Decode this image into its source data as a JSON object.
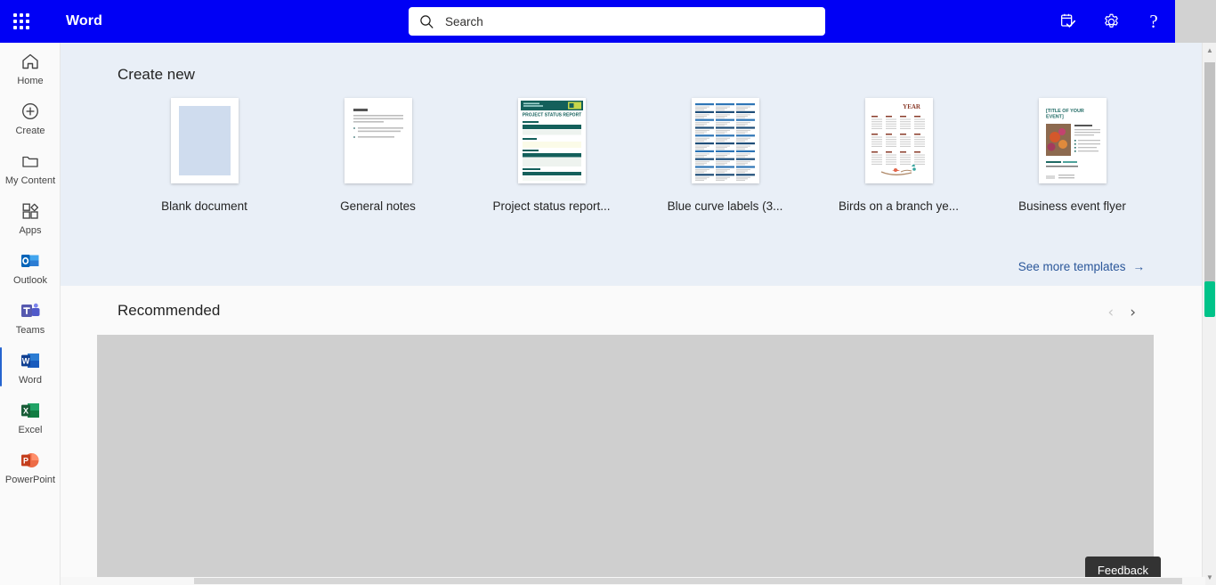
{
  "topbar": {
    "waffle_label": "app-launcher",
    "app_title": "Word",
    "search": {
      "placeholder": "Search",
      "value": ""
    },
    "actions": [
      {
        "name": "tasks-icon",
        "label": "Tasks"
      },
      {
        "name": "gear-icon",
        "label": "Settings"
      },
      {
        "name": "help-icon",
        "label": "?"
      }
    ],
    "help_glyph": "?",
    "brand_color": "#0000f5"
  },
  "rail": {
    "items": [
      {
        "label": "Home",
        "icon": "home-icon",
        "selected": false
      },
      {
        "label": "Create",
        "icon": "plus-circle-icon",
        "selected": false
      },
      {
        "label": "My Content",
        "icon": "folder-icon",
        "selected": false
      },
      {
        "label": "Apps",
        "icon": "apps-grid-icon",
        "selected": false
      },
      {
        "label": "Outlook",
        "icon": "outlook-icon",
        "selected": false
      },
      {
        "label": "Teams",
        "icon": "teams-icon",
        "selected": false
      },
      {
        "label": "Word",
        "icon": "word-icon",
        "selected": true
      },
      {
        "label": "Excel",
        "icon": "excel-icon",
        "selected": false
      },
      {
        "label": "PowerPoint",
        "icon": "powerpoint-icon",
        "selected": false
      }
    ]
  },
  "create_new": {
    "title": "Create new",
    "see_more": "See more templates",
    "see_more_arrow": "→",
    "templates": [
      {
        "label": "Blank document",
        "kind": "blank"
      },
      {
        "label": "General notes",
        "kind": "notes"
      },
      {
        "label": "Project status report...",
        "kind": "status-report"
      },
      {
        "label": "Blue curve labels (3...",
        "kind": "labels"
      },
      {
        "label": "Birds on a branch ye...",
        "kind": "calendar"
      },
      {
        "label": "Business event flyer",
        "kind": "flyer"
      }
    ]
  },
  "recommended": {
    "title": "Recommended",
    "prev_glyph": "‹",
    "next_glyph": "›"
  },
  "feedback": {
    "label": "Feedback"
  },
  "scrollbars": {
    "v_up_glyph": "▲",
    "v_down_glyph": "▼",
    "marker_color": "#00c389"
  }
}
